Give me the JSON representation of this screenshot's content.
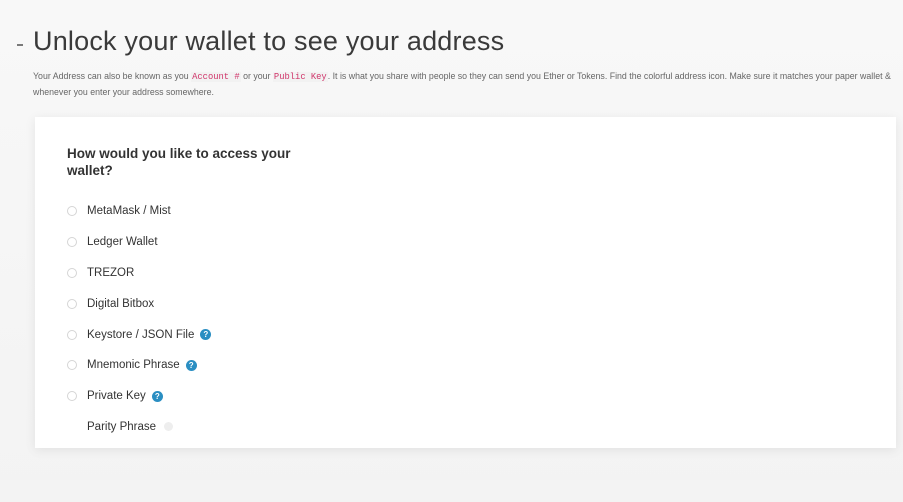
{
  "page": {
    "heading": "Unlock your wallet to see your address",
    "description": {
      "part1": "Your Address can also be known as you ",
      "account_code": "Account #",
      "part2": " or your ",
      "public_key_code": "Public Key",
      "part3": ". It is what you share with people so they can send you Ether or Tokens. Find the colorful address icon. Make sure it matches your paper wallet & whenever you enter your address somewhere."
    }
  },
  "access": {
    "question": "How would you like to access your wallet?",
    "options": [
      {
        "label": "MetaMask / Mist",
        "help": false
      },
      {
        "label": "Ledger Wallet",
        "help": false
      },
      {
        "label": "TREZOR",
        "help": false
      },
      {
        "label": "Digital Bitbox",
        "help": false
      },
      {
        "label": "Keystore / JSON File",
        "help": true
      },
      {
        "label": "Mnemonic Phrase",
        "help": true
      },
      {
        "label": "Private Key",
        "help": true
      },
      {
        "label": "Parity Phrase",
        "help": false
      }
    ],
    "help_glyph": "?"
  },
  "colors": {
    "accent": "#2a8ec2",
    "code_text": "#d0356a"
  },
  "icons": {
    "help": "question-circle-icon",
    "radio": "radio-circle-icon"
  }
}
